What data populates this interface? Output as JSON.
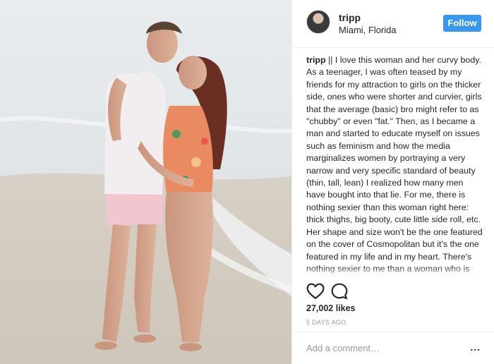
{
  "post": {
    "username": "tripp",
    "location": "Miami, Florida",
    "follow_label": "Follow",
    "caption_user": "tripp",
    "caption_text": " || I love this woman and her curvy body. As a teenager, I was often teased by my friends for my attraction to girls on the thicker side, ones who were shorter and curvier, girls that the average (basic) bro might refer to as \"chubby\" or even \"fat.\" Then, as I became a man and started to educate myself on issues such as feminism and how the media marginalizes women by portraying a very narrow and very specific standard of beauty (thin, tall, lean) I realized how many men have bought into that lie. For me, there is nothing sexier than this woman right here: thick thighs, big booty, cute little side roll, etc. Her shape and size won't be the one featured on the cover of Cosmopolitan but it's the one featured in my life and in my heart. There's nothing sexier to me than a woman who is both curvy and confident; this gorgeous girl I married fills out every inch of her jeans and is still the most",
    "likes": "27,002 likes",
    "time": "5 DAYS AGO",
    "comment_placeholder": "Add a comment…",
    "more": "..."
  },
  "icons": {
    "heart": "heart-icon",
    "comment": "comment-icon",
    "more": "more-options-icon"
  },
  "colors": {
    "follow_button": "#3897f0",
    "text": "#262626",
    "muted": "#999999",
    "divider": "#efefef"
  }
}
